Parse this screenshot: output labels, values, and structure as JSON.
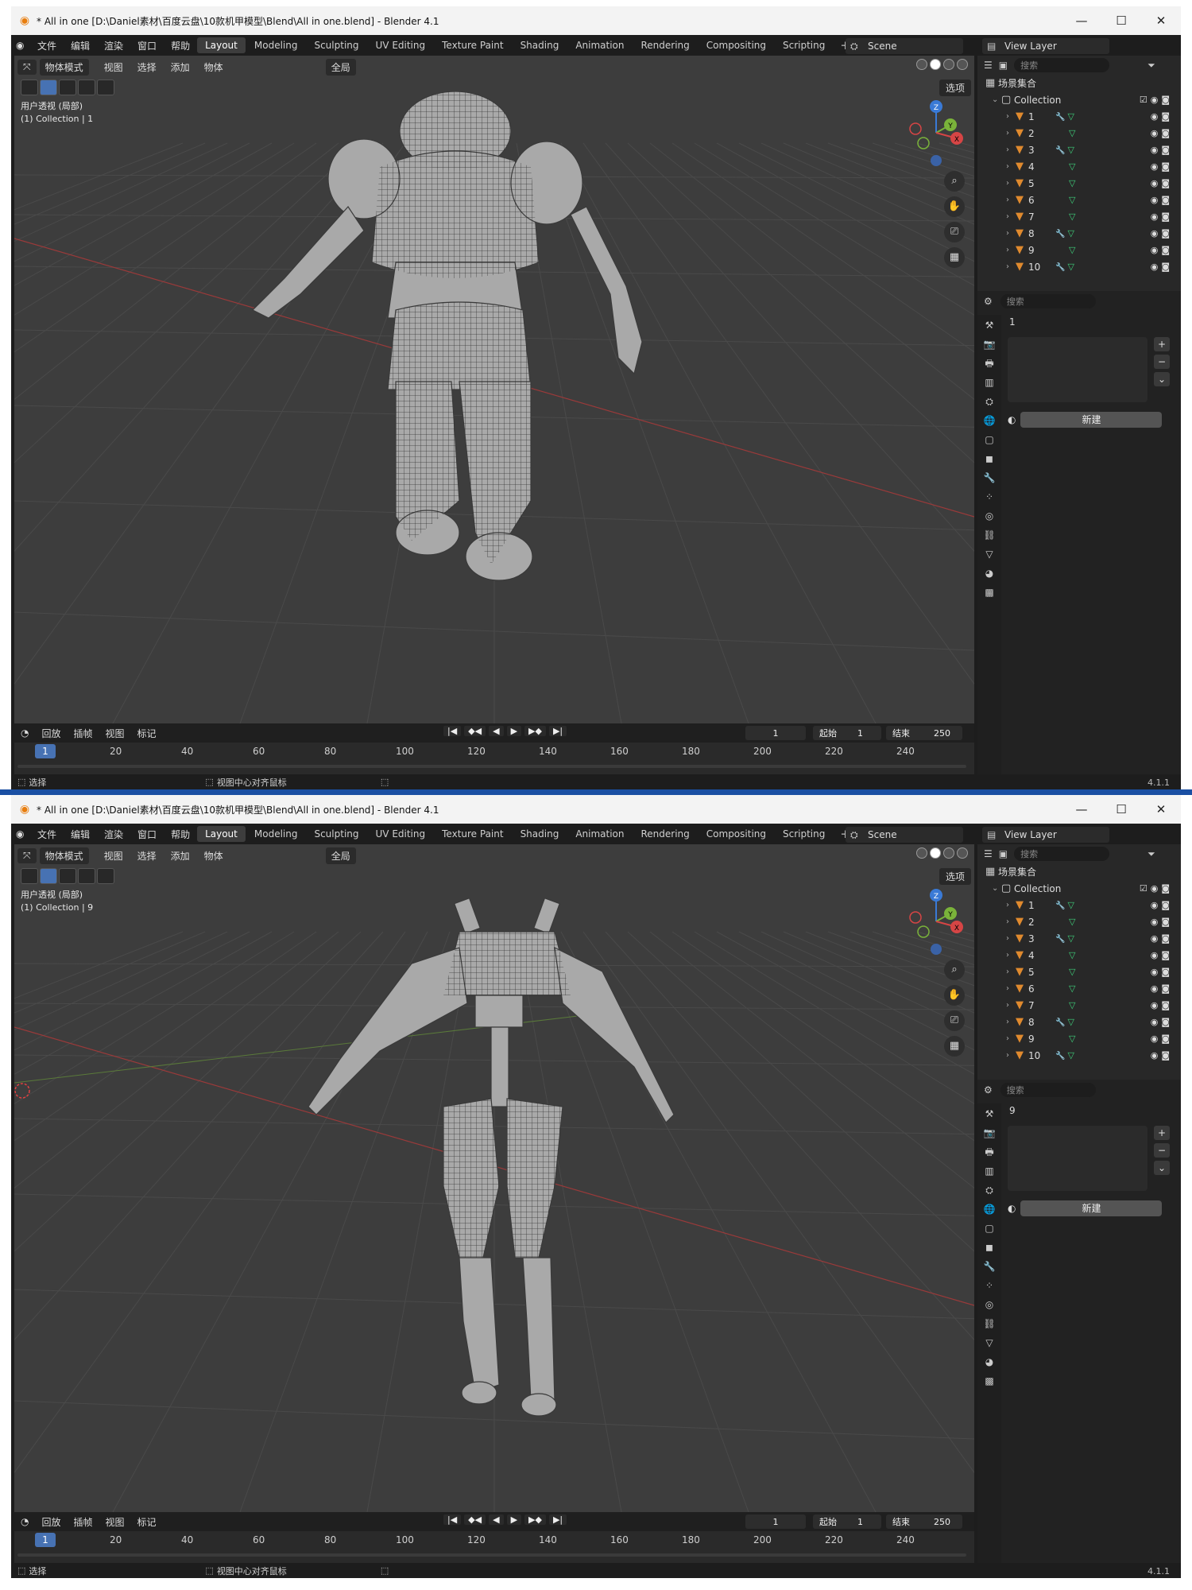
{
  "app": {
    "brand_color": "#e87d0d",
    "accent": "#4772b3"
  },
  "windows": [
    {
      "title": "* All in one [D:\\Daniel素材\\百度云盘\\10款机甲模型\\Blend\\All in one.blend] - Blender 4.1",
      "minimize": "—",
      "maximize": "☐",
      "close": "✕",
      "menu": [
        "文件",
        "编辑",
        "渲染",
        "窗口",
        "帮助"
      ],
      "tabs": [
        "Layout",
        "Modeling",
        "Sculpting",
        "UV Editing",
        "Texture Paint",
        "Shading",
        "Animation",
        "Rendering",
        "Compositing",
        "Scripting"
      ],
      "active_tab": "Layout",
      "scene": "Scene",
      "view_layer": "View Layer",
      "viewport": {
        "mode": "物体模式",
        "menu": [
          "视图",
          "选择",
          "添加",
          "物体"
        ],
        "transform_orient": "全局",
        "options": "选项",
        "label_line1": "用户透视 (局部)",
        "label_line2": "(1) Collection | 1",
        "robot": "armored",
        "axis_labels": {
          "z": "Z",
          "y": "Y",
          "x": "X"
        }
      },
      "timeline": {
        "menu": [
          "回放",
          "插帧",
          "视图",
          "标记"
        ],
        "current_frame": "1",
        "start_label": "起始",
        "start": "1",
        "end_label": "结束",
        "end": "250",
        "ticks": [
          "20",
          "40",
          "60",
          "80",
          "100",
          "120",
          "140",
          "160",
          "180",
          "200",
          "220",
          "240"
        ],
        "cursor": "1"
      },
      "status": {
        "select": "选择",
        "center": "视图中心对齐鼠标",
        "version": "4.1.1"
      },
      "outliner": {
        "search": "搜索",
        "scene_collection": "场景集合",
        "collection": "Collection",
        "items": [
          {
            "name": "1",
            "wrench": true
          },
          {
            "name": "2",
            "wrench": false
          },
          {
            "name": "3",
            "wrench": true
          },
          {
            "name": "4",
            "wrench": false
          },
          {
            "name": "5",
            "wrench": false
          },
          {
            "name": "6",
            "wrench": false
          },
          {
            "name": "7",
            "wrench": false
          },
          {
            "name": "8",
            "wrench": true
          },
          {
            "name": "9",
            "wrench": false
          },
          {
            "name": "10",
            "wrench": true
          }
        ]
      },
      "properties": {
        "search": "搜索",
        "object": "1",
        "new_label": "新建"
      }
    },
    {
      "title": "* All in one [D:\\Daniel素材\\百度云盘\\10款机甲模型\\Blend\\All in one.blend] - Blender 4.1",
      "minimize": "—",
      "maximize": "☐",
      "close": "✕",
      "menu": [
        "文件",
        "编辑",
        "渲染",
        "窗口",
        "帮助"
      ],
      "tabs": [
        "Layout",
        "Modeling",
        "Sculpting",
        "UV Editing",
        "Texture Paint",
        "Shading",
        "Animation",
        "Rendering",
        "Compositing",
        "Scripting"
      ],
      "active_tab": "Layout",
      "scene": "Scene",
      "view_layer": "View Layer",
      "viewport": {
        "mode": "物体模式",
        "menu": [
          "视图",
          "选择",
          "添加",
          "物体"
        ],
        "transform_orient": "全局",
        "options": "选项",
        "label_line1": "用户透视 (局部)",
        "label_line2": "(1) Collection | 9",
        "robot": "skeletal",
        "axis_labels": {
          "z": "Z",
          "y": "Y",
          "x": "X"
        }
      },
      "timeline": {
        "menu": [
          "回放",
          "插帧",
          "视图",
          "标记"
        ],
        "current_frame": "1",
        "start_label": "起始",
        "start": "1",
        "end_label": "结束",
        "end": "250",
        "ticks": [
          "20",
          "40",
          "60",
          "80",
          "100",
          "120",
          "140",
          "160",
          "180",
          "200",
          "220",
          "240"
        ],
        "cursor": "1"
      },
      "status": {
        "select": "选择",
        "center": "视图中心对齐鼠标",
        "version": "4.1.1"
      },
      "outliner": {
        "search": "搜索",
        "scene_collection": "场景集合",
        "collection": "Collection",
        "items": [
          {
            "name": "1",
            "wrench": true
          },
          {
            "name": "2",
            "wrench": false
          },
          {
            "name": "3",
            "wrench": true
          },
          {
            "name": "4",
            "wrench": false
          },
          {
            "name": "5",
            "wrench": false
          },
          {
            "name": "6",
            "wrench": false
          },
          {
            "name": "7",
            "wrench": false
          },
          {
            "name": "8",
            "wrench": true
          },
          {
            "name": "9",
            "wrench": false
          },
          {
            "name": "10",
            "wrench": true
          }
        ]
      },
      "properties": {
        "search": "搜索",
        "object": "9",
        "new_label": "新建"
      }
    }
  ]
}
